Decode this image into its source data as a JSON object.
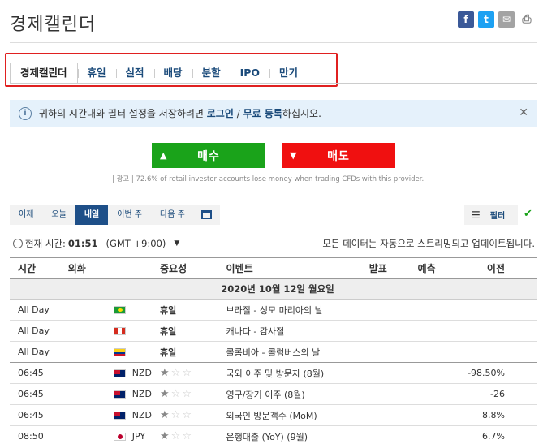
{
  "page": {
    "title": "경제캘린더"
  },
  "share": {
    "fb": "f",
    "tw": "t",
    "mail": "✉",
    "print": "⎙"
  },
  "tabs": [
    "경제캘린더",
    "휴일",
    "실적",
    "배당",
    "분할",
    "IPO",
    "만기"
  ],
  "notice": {
    "pre": "귀하의 시간대와 필터 설정을 저장하려면 ",
    "login": "로그인",
    "sep": " / ",
    "signup": "무료 등록",
    "post": "하십시오.",
    "close": "✕"
  },
  "cta": {
    "buy": "매수",
    "sell": "매도",
    "buy_arrow": "▲",
    "sell_arrow": "▼"
  },
  "disclaimer": "| 광고 | 72.6% of retail investor accounts lose money when trading CFDs with this provider.",
  "date_buttons": [
    "어제",
    "오늘",
    "내일",
    "이번 주",
    "다음 주"
  ],
  "filter": {
    "label": "필터",
    "icon": "☰"
  },
  "check": "✔",
  "clock": {
    "label": "현재 시간:",
    "time": "01:51",
    "tz": "(GMT +9:00)",
    "dropdown": "▼"
  },
  "auto_update": "모든 데이터는 자동으로 스트리밍되고 업데이트됩니다.",
  "table": {
    "headers": [
      "시간",
      "외화",
      "중요성",
      "이벤트",
      "발표",
      "예측",
      "이전"
    ],
    "date_row": "2020년 10월 12일 월요일",
    "holidays": [
      {
        "time": "All Day",
        "importance": "휴일",
        "event": "브라질 - 성모 마리아의 날"
      },
      {
        "time": "All Day",
        "importance": "휴일",
        "event": "캐나다 - 감사절"
      },
      {
        "time": "All Day",
        "importance": "휴일",
        "event": "콜롬비아 - 콜럼버스의 날"
      }
    ],
    "events": [
      {
        "time": "06:45",
        "currency": "NZD",
        "event": "국외 이주 및 방문자 (8월)",
        "previous": "-98.50%"
      },
      {
        "time": "06:45",
        "currency": "NZD",
        "event": "영구/장기 이주 (8월)",
        "previous": "-26"
      },
      {
        "time": "06:45",
        "currency": "NZD",
        "event": "외국인 방문객수 (MoM)",
        "previous": "8.8%"
      },
      {
        "time": "08:50",
        "currency": "JPY",
        "event": "은행대출 (YoY) (9월)",
        "previous": "6.7%"
      }
    ],
    "event_importance_stars": [
      1,
      1,
      1,
      1
    ],
    "star_char": "★",
    "star_empty_char": "☆"
  },
  "colors": {
    "buy": "#1aa31a",
    "sell": "#f01010",
    "accent": "#1e4f88",
    "highlight": "#e02020"
  }
}
